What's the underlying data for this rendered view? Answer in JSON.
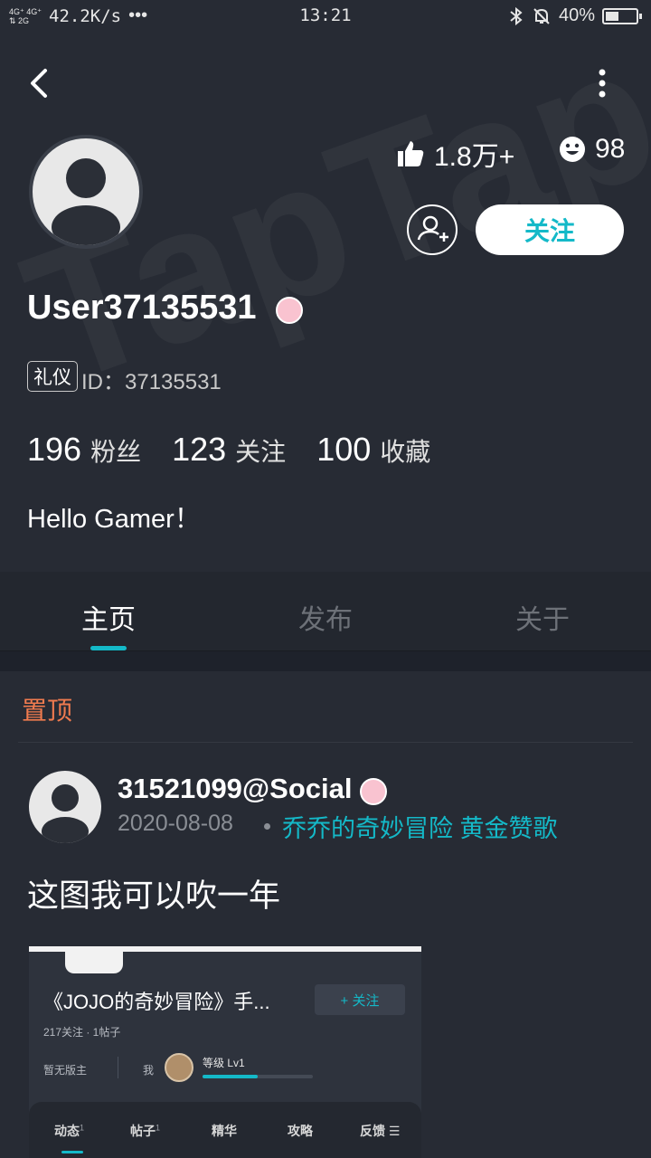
{
  "status_bar": {
    "signal": "4G⁺ 4G⁺\n⇅ 2G",
    "speed": "42.2K/s",
    "dots": "•••",
    "time": "13:21",
    "battery_text": "40%",
    "battery_level": 0.4
  },
  "header": {
    "watermark": "TapTap",
    "likes": "1.8万+",
    "smiles": "98",
    "follow_label": "关注",
    "username": "User37135531",
    "etiquette_tag": "礼仪",
    "user_id": "ID：37135531",
    "stats": [
      {
        "value": "196",
        "label": "粉丝"
      },
      {
        "value": "123",
        "label": "关注"
      },
      {
        "value": "100",
        "label": "收藏"
      }
    ],
    "bio": "Hello Gamer！"
  },
  "tabs": [
    {
      "label": "主页",
      "active": true
    },
    {
      "label": "发布",
      "active": false
    },
    {
      "label": "关于",
      "active": false
    }
  ],
  "feed": {
    "pinned_label": "置顶",
    "post": {
      "user": "31521099@Social",
      "date": "2020-08-08",
      "games": "乔乔的奇妙冒险 黄金赞歌",
      "text": "这图我可以吹一年",
      "embed": {
        "title": "《JOJO的奇妙冒险》手...",
        "follow_label": "+ 关注",
        "meta": "217关注 · 1帖子",
        "no_moderator": "暂无版主",
        "me_label": "我",
        "level": "等级 Lv1",
        "level_progress": 0.5,
        "sub_tabs": [
          {
            "label": "动态",
            "count": "1"
          },
          {
            "label": "帖子",
            "count": "1"
          },
          {
            "label": "精华",
            "count": ""
          },
          {
            "label": "攻略",
            "count": ""
          },
          {
            "label": "反馈",
            "count": ""
          }
        ]
      }
    }
  },
  "colors": {
    "accent": "#14b9c8",
    "pinned": "#f07b4f",
    "background": "#272b34"
  }
}
